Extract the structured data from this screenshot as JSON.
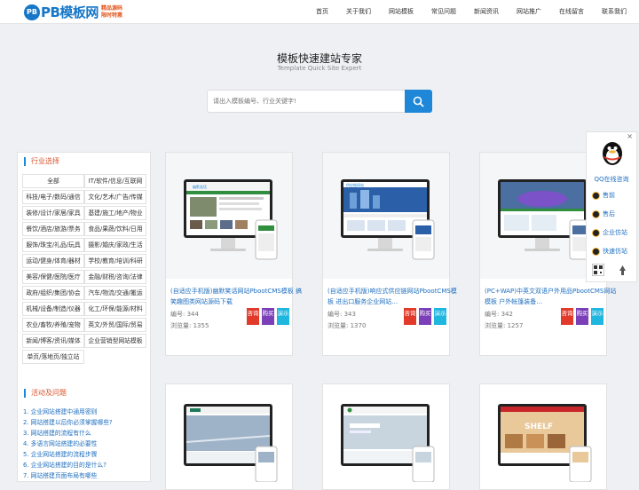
{
  "header": {
    "logo_badge": "PB",
    "logo_name": "PB模板网",
    "logo_tag1": "精品源码",
    "logo_tag2": "限时特惠",
    "nav": [
      "首页",
      "关于我们",
      "网站模板",
      "常见问题",
      "新闻资讯",
      "网站推广",
      "在线留言",
      "联系我们"
    ]
  },
  "hero": {
    "title": "模板快速建站专家",
    "subtitle": "Template Quick Site Expert",
    "search_placeholder": "请出入模板编号、行业关键字!"
  },
  "sidebar": {
    "industry_title": "行业选择",
    "categories": [
      "全部",
      "IT/软件/信息/互联网",
      "科技/电子/数码/通信",
      "文化/艺术/广告/传媒",
      "装修/设计/家居/家具",
      "基建/施工/地产/物业",
      "餐饮/酒店/旅游/票务",
      "食品/果蔬/饮料/日用",
      "服饰/珠宝/礼品/玩具",
      "摄影/婚庆/家政/生活",
      "运动/健身/体育/器材",
      "学校/教育/培训/科研",
      "美容/保健/医院/医疗",
      "金融/财税/咨询/法律",
      "政府/组织/集团/协会",
      "汽车/物流/交通/搬运",
      "机械/设备/制造/仪器",
      "化工/环保/能源/材料",
      "农业/畜牧/养殖/宠物",
      "英文/外贸/国际/贸易",
      "新闻/博客/资讯/媒体",
      "企业营销型网站模板",
      "单页/落地页/独立站"
    ],
    "faq_title": "活动及问题",
    "faqs": [
      "1. 企业网站搭建中通用密则",
      "2. 网站搭建以后你必须掌握哪些?",
      "3. 网站搭建的流程有什么",
      "4. 多语言网站搭建的必要性",
      "5. 企业网站搭建的流程步骤",
      "6. 企业网站搭建的目的是什么?",
      "7. 网站搭建页面布局有哪些"
    ]
  },
  "cards": [
    {
      "title": "(自适应手机版)幽默笑话网站PbootCMS模板 搞笑趣图类网站源码下载",
      "code_label": "编号:",
      "code": "344",
      "views_label": "浏览量:",
      "views": "1355"
    },
    {
      "title": "(自适应手机版)响应式供应链网站PbootCMS模板 进出口服务企业网站…",
      "code_label": "编号:",
      "code": "343",
      "views_label": "浏览量:",
      "views": "1370"
    },
    {
      "title": "(PC+WAP)中英文双语户外用品PbootCMS网站模板 户外帐篷装备…",
      "code_label": "编号:",
      "code": "342",
      "views_label": "浏览量:",
      "views": "1257"
    }
  ],
  "card_buttons": {
    "buy": "购买",
    "demo": "演示",
    "ask": "咨询"
  },
  "screen_previews": {
    "c1_logo": "幽默笑话",
    "c2_logo": "供应链网站",
    "c3_sign": "SHELF"
  },
  "float_panel": {
    "title": "QQ在线咨询",
    "items": [
      "售前",
      "售后",
      "企业仿站",
      "快速仿站"
    ],
    "close": "×"
  },
  "colors": {
    "accent": "#1e87d8",
    "link": "#1f6fbf",
    "orange": "#d9532c"
  }
}
